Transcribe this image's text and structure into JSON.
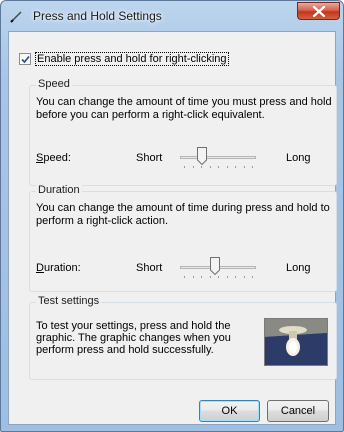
{
  "window": {
    "title": "Press and Hold Settings",
    "close_icon": "close-icon",
    "accent": "#c2361d"
  },
  "enable": {
    "label": "Enable press and hold for right-clicking",
    "checked": true
  },
  "speed": {
    "title": "Speed",
    "description": "You can change the amount of time you must press and hold before you can perform a right-click equivalent.",
    "label": "Speed:",
    "short": "Short",
    "long": "Long",
    "value": 0.25
  },
  "duration": {
    "title": "Duration",
    "description": "You can change the amount of time during press and hold to perform a right-click action.",
    "label": "Duration:",
    "short": "Short",
    "long": "Long",
    "value": 0.45
  },
  "test": {
    "title": "Test settings",
    "description": "To test your settings, press and hold the graphic. The graphic changes when you perform press and hold successfully.",
    "graphic_icon": "light-bulb-icon"
  },
  "buttons": {
    "ok": "OK",
    "cancel": "Cancel"
  }
}
